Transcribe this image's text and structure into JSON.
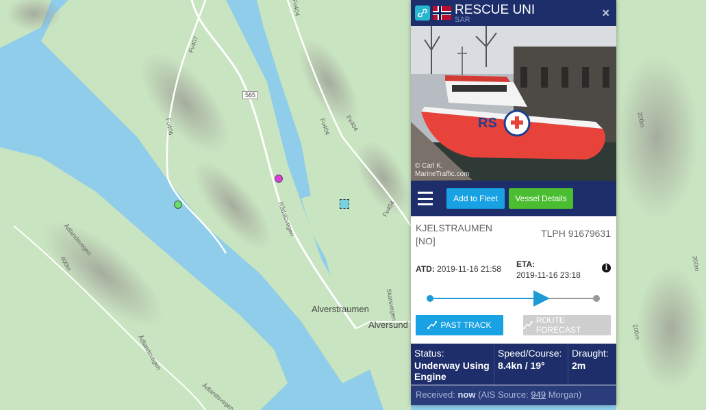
{
  "map": {
    "place_labels": [
      "Alverstraumen",
      "Alversund"
    ],
    "road_labels": [
      "Fv404",
      "Fv407",
      "Fv406",
      "Fv404",
      "Fv404",
      "Rådalsvegen",
      "Skarsvegen",
      "Ådlandsvegen",
      "Ådlandsvegen",
      "Ådlandsvegen",
      "Fv404"
    ],
    "road_shield": "565",
    "contour_labels": [
      "200m",
      "200m",
      "200m",
      "400m"
    ]
  },
  "panel": {
    "vessel_name": "RESCUE UNI",
    "vessel_type": "SAR",
    "close": "×",
    "photo": {
      "credit": "© Carl K.",
      "watermark": "MarineTraffic.com"
    },
    "actions": {
      "add_fleet": "Add to Fleet",
      "details": "Vessel Details"
    },
    "destination": "KJELSTRAUMEN [NO]",
    "phone": "TLPH 91679631",
    "atd_label": "ATD:",
    "atd_value": "2019-11-16 21:58",
    "eta_label": "ETA:",
    "eta_value": "2019-11-16 23:18",
    "voyage_progress": 0.7,
    "past_track": "PAST TRACK",
    "route_forecast": "ROUTE FORECAST",
    "status": {
      "status_label": "Status:",
      "status_value": "Underway Using Engine",
      "speed_label": "Speed/Course:",
      "speed_value": "8.4kn / 19°",
      "draught_label": "Draught:",
      "draught_value": "2m"
    },
    "received": {
      "label": "Received:",
      "when": "now",
      "source_prefix": "(AIS Source:",
      "source_id": "949",
      "source_suffix": "Morgan)"
    }
  },
  "colors": {
    "header": "#1d2e6b",
    "accent_blue": "#18a2e4",
    "accent_green": "#4bbd30",
    "water": "#8fcdea",
    "land": "#c9e4c1"
  }
}
